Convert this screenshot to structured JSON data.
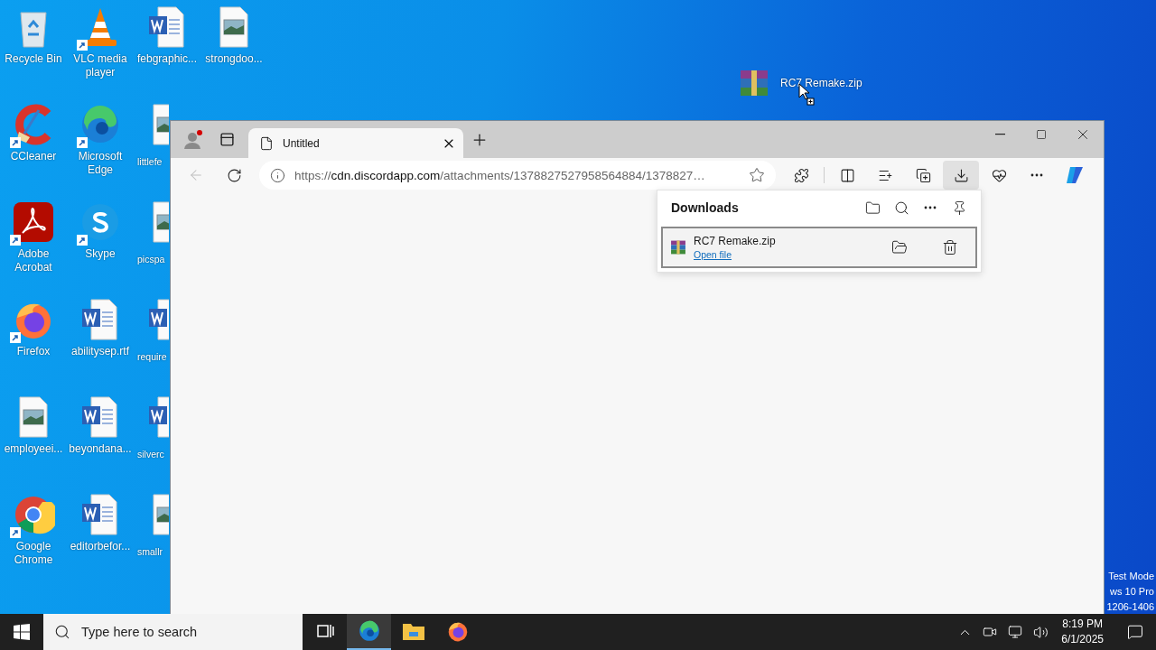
{
  "desktop": {
    "columns": [
      [
        {
          "label": "Recycle Bin",
          "kind": "recycle",
          "shortcut": false
        },
        {
          "label": "CCleaner",
          "kind": "ccleaner",
          "shortcut": true
        },
        {
          "label": "Adobe Acrobat",
          "kind": "acrobat",
          "shortcut": true
        },
        {
          "label": "Firefox",
          "kind": "firefox",
          "shortcut": true
        },
        {
          "label": "employeei...",
          "kind": "image",
          "shortcut": false
        },
        {
          "label": "Google Chrome",
          "kind": "chrome",
          "shortcut": true
        }
      ],
      [
        {
          "label": "VLC media player",
          "kind": "vlc",
          "shortcut": true
        },
        {
          "label": "Microsoft Edge",
          "kind": "edge",
          "shortcut": true
        },
        {
          "label": "Skype",
          "kind": "skype",
          "shortcut": true
        },
        {
          "label": "abilitysep.rtf",
          "kind": "word",
          "shortcut": false
        },
        {
          "label": "beyondana...",
          "kind": "word",
          "shortcut": false
        },
        {
          "label": "editorbefor...",
          "kind": "word",
          "shortcut": false
        }
      ],
      [
        {
          "label": "febgraphic...",
          "kind": "word",
          "shortcut": false
        },
        {
          "label": "littlefe",
          "kind": "image",
          "shortcut": false
        },
        {
          "label": "picspa",
          "kind": "image",
          "shortcut": false
        },
        {
          "label": "require",
          "kind": "word",
          "shortcut": false
        },
        {
          "label": "silverc",
          "kind": "word",
          "shortcut": false
        },
        {
          "label": "smallr",
          "kind": "image",
          "shortcut": false
        }
      ],
      [
        {
          "label": "strongdoo...",
          "kind": "image",
          "shortcut": false
        }
      ]
    ],
    "dragged_item": {
      "label": "RC7 Remake.zip",
      "kind": "archive"
    },
    "edition_notice": [
      "Test Mode",
      "ws 10 Pro",
      "1206-1406"
    ]
  },
  "browser": {
    "tabs": [
      {
        "title": "Untitled",
        "selected": true
      }
    ],
    "back_disabled": true,
    "address": [
      {
        "text": "https://",
        "strong": false
      },
      {
        "text": "cdn.discordapp.com",
        "strong": true
      },
      {
        "text": "/attachments/1378827527958564884/1378827…",
        "strong": false
      }
    ],
    "toolbar": [
      {
        "kind": "extensions",
        "selected": false
      },
      {
        "kind": "split",
        "selected": false
      },
      {
        "kind": "favorites",
        "selected": false
      },
      {
        "kind": "collections",
        "selected": false
      },
      {
        "kind": "downloads",
        "selected": true
      },
      {
        "kind": "essentials",
        "selected": false
      },
      {
        "kind": "more",
        "selected": false
      },
      {
        "kind": "copilot",
        "selected": false
      }
    ],
    "downloads": {
      "title": "Downloads",
      "items": [
        {
          "name": "RC7 Remake.zip",
          "action": "Open file"
        }
      ]
    }
  },
  "taskbar": {
    "search": {
      "placeholder": "Type here to search"
    },
    "apps": [
      {
        "kind": "task-view",
        "active": false
      },
      {
        "kind": "edge",
        "active": true
      },
      {
        "kind": "explorer",
        "active": false
      },
      {
        "kind": "firefox",
        "active": false
      }
    ],
    "clock": {
      "time": "8:19 PM",
      "date": "6/1/2025"
    }
  }
}
